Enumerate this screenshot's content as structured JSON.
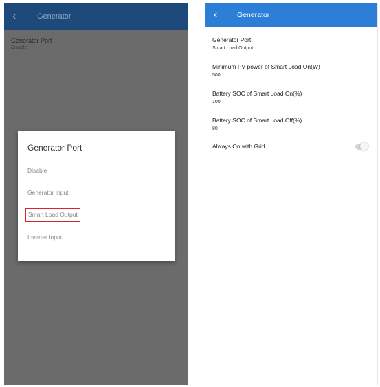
{
  "left_screen": {
    "appbar": {
      "back_glyph": "‹",
      "title": "Generator"
    },
    "setting": {
      "label": "Generator Port",
      "value": "Disable"
    },
    "dialog": {
      "title": "Generator Port",
      "options": [
        {
          "label": "Disable",
          "selected": false
        },
        {
          "label": "Generator Input",
          "selected": false
        },
        {
          "label": "Smart Load Output",
          "selected": true
        },
        {
          "label": "Inverter Input",
          "selected": false
        }
      ]
    }
  },
  "right_screen": {
    "appbar": {
      "back_glyph": "‹",
      "title": "Generator"
    },
    "settings": [
      {
        "label": "Generator Port",
        "value": "Smart Load Output"
      },
      {
        "label": "Minimum PV power of Smart Load On(W)",
        "value": "500"
      },
      {
        "label": "Battery SOC of Smart Load On(%)",
        "value": "100"
      },
      {
        "label": "Battery SOC of Smart Load Off(%)",
        "value": "80"
      }
    ],
    "toggle_setting": {
      "label": "Always On with Grid",
      "state": "off"
    }
  },
  "colors": {
    "left_appbar": "#1d4a7a",
    "left_overlay": "#6b6b6b",
    "right_appbar": "#2d7ed6",
    "highlight_border": "#d8262e"
  }
}
